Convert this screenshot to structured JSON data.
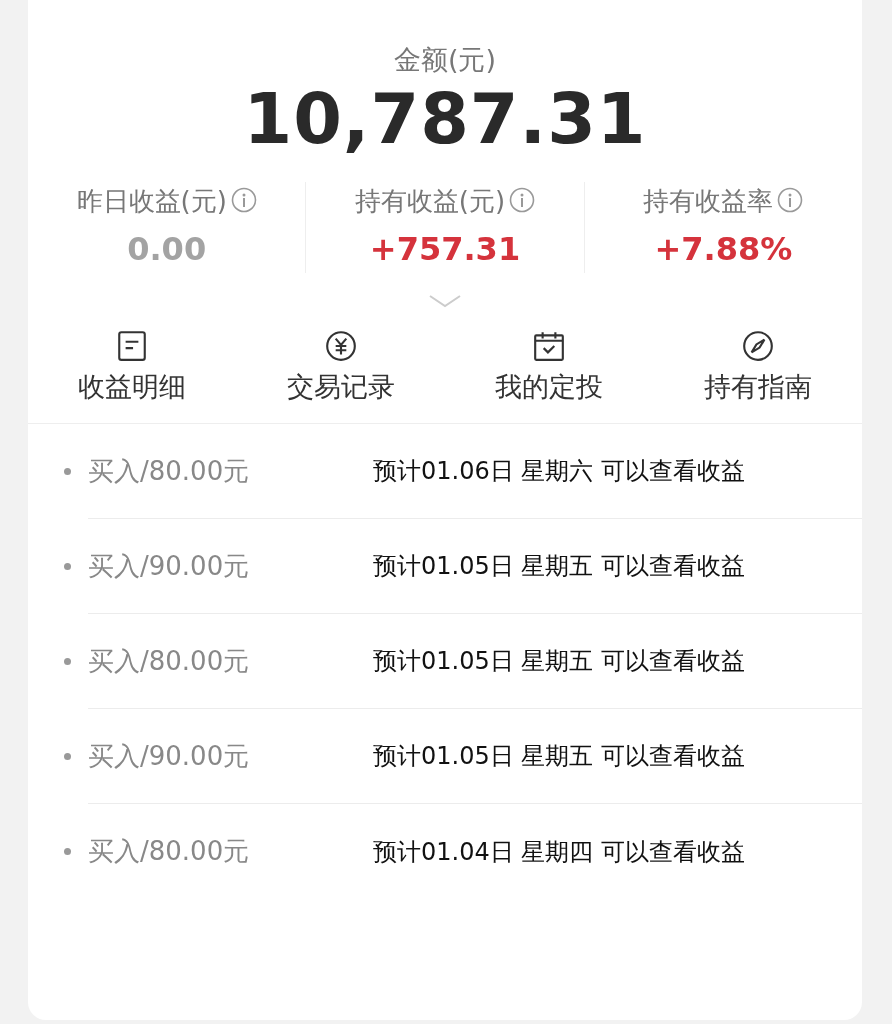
{
  "amount": {
    "label": "金额(元)",
    "value": "10,787.31"
  },
  "stats": [
    {
      "label": "昨日收益(元)",
      "value": "0.00",
      "color": "#a3a3a3"
    },
    {
      "label": "持有收益(元)",
      "value": "+757.31",
      "color": "#d5333c"
    },
    {
      "label": "持有收益率",
      "value": "+7.88%",
      "color": "#d5333c"
    }
  ],
  "shortcuts": [
    {
      "label": "收益明细",
      "kind": "document"
    },
    {
      "label": "交易记录",
      "kind": "yuan"
    },
    {
      "label": "我的定投",
      "kind": "calendar"
    },
    {
      "label": "持有指南",
      "kind": "compass"
    }
  ],
  "records": [
    {
      "action": "买入/80.00元",
      "note": "预计01.06日 星期六 可以查看收益"
    },
    {
      "action": "买入/90.00元",
      "note": "预计01.05日 星期五 可以查看收益"
    },
    {
      "action": "买入/80.00元",
      "note": "预计01.05日 星期五 可以查看收益"
    },
    {
      "action": "买入/90.00元",
      "note": "预计01.05日 星期五 可以查看收益"
    },
    {
      "action": "买入/80.00元",
      "note": "预计01.04日 星期四 可以查看收益"
    }
  ]
}
